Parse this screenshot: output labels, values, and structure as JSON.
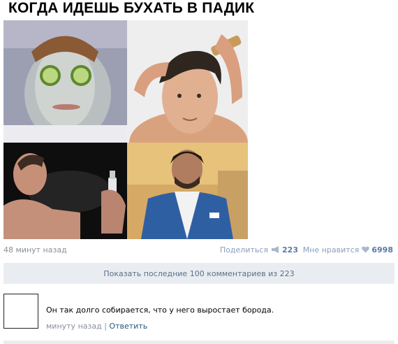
{
  "post": {
    "title": "КОГДА ИДЕШЬ БУХАТЬ В ПАДИК",
    "time": "48 минут назад",
    "share_label": "Поделиться",
    "share_count": "223",
    "like_label": "Мне нравится",
    "like_count": "6998"
  },
  "comments": {
    "show_label": "Показать последние 100 комментариев из 223",
    "items": [
      {
        "text": "Он так долго собирается, что у него выростает борода.",
        "time": "минуту назад",
        "separator": "|",
        "reply_label": "Ответить"
      }
    ]
  },
  "colors": {
    "link": "#2b587a",
    "bar_bg": "#e9edf1",
    "muted": "#8a9099"
  }
}
